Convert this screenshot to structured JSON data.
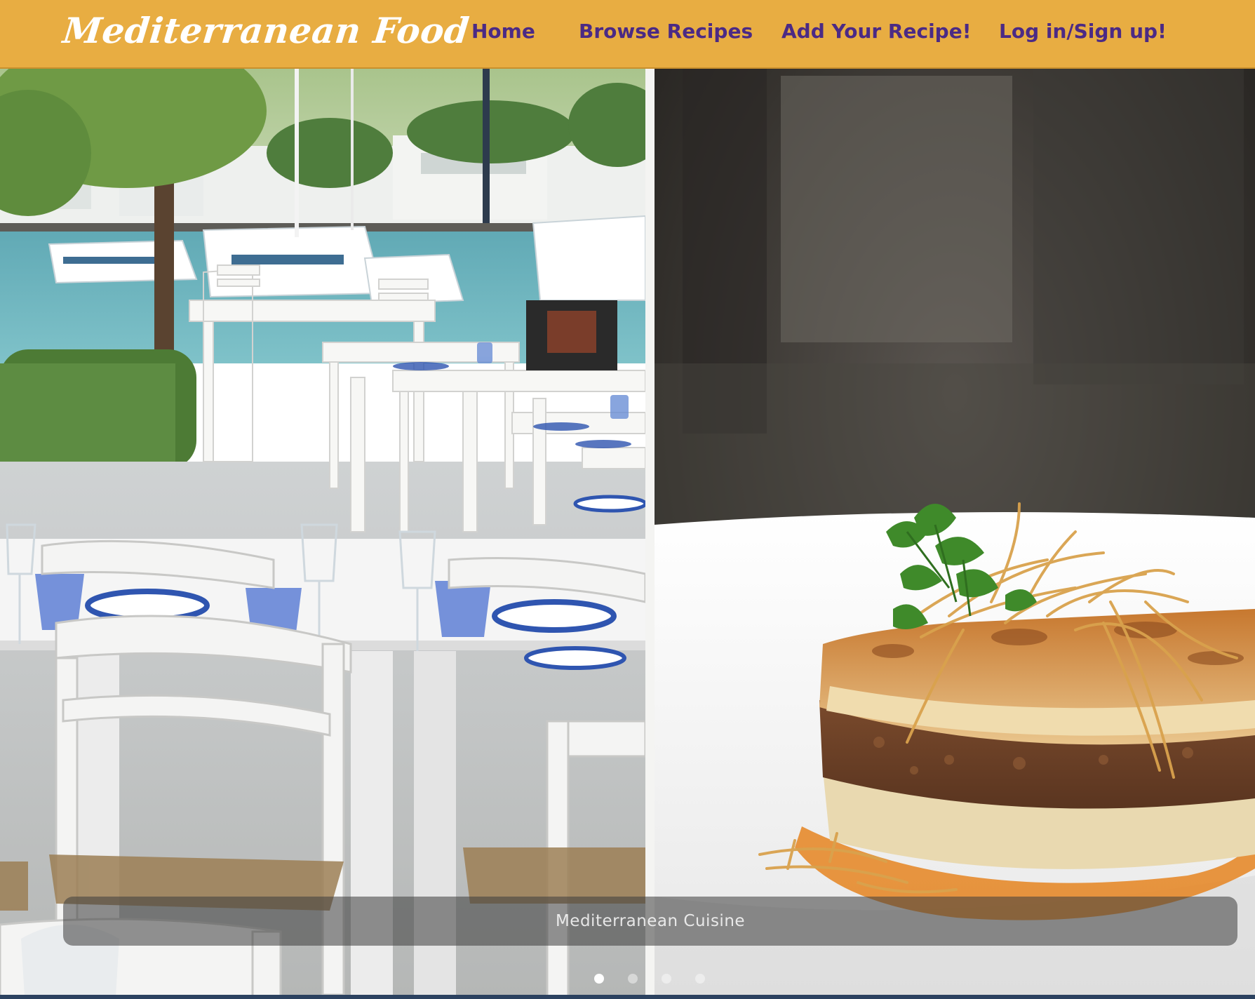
{
  "navbar": {
    "brand": "Mediterranean Food",
    "links": [
      {
        "label": "Home"
      },
      {
        "label": "Browse Recipes"
      },
      {
        "label": "Add Your Recipe!"
      },
      {
        "label": "Log in/Sign up!"
      }
    ],
    "background_color": "#e8ad42",
    "link_color": "#4b2a85"
  },
  "carousel": {
    "caption": "Mediterranean Cuisine",
    "slides": [
      {
        "image": "harbor-restaurant-terrace-photo"
      },
      {
        "image": "moussaka-dish-photo"
      }
    ],
    "indicators": [
      {
        "active": true
      },
      {
        "active": false
      },
      {
        "active": false
      },
      {
        "active": false
      }
    ]
  }
}
